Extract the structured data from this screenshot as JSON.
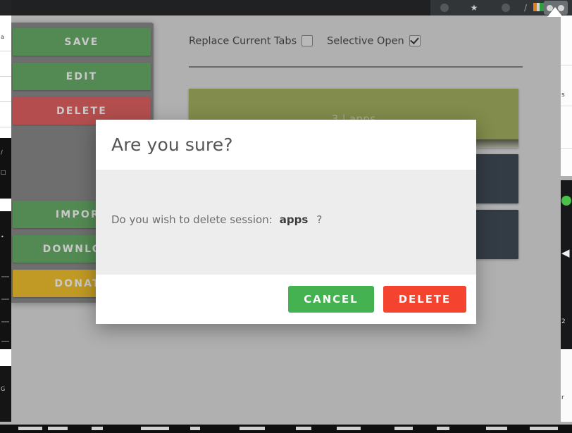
{
  "browser_chrome": {
    "icons": [
      "clock-icon",
      "star-icon",
      "account-circle-icon",
      "slash-icon",
      "extension-icon",
      "avatar-icon"
    ]
  },
  "sidebar": {
    "buttons": [
      {
        "label": "SAVE",
        "style": "green",
        "name": "save-button"
      },
      {
        "label": "EDIT",
        "style": "green",
        "name": "edit-button"
      },
      {
        "label": "DELETE",
        "style": "red",
        "name": "delete-button"
      },
      {
        "label": "IMPORT",
        "style": "green",
        "name": "import-button"
      },
      {
        "label": "DOWNLOAD",
        "style": "green",
        "name": "download-button"
      },
      {
        "label": "DONATE",
        "style": "gold",
        "name": "donate-button"
      }
    ]
  },
  "options": {
    "replace_current_tabs": {
      "label": "Replace Current Tabs",
      "checked": false
    },
    "selective_open": {
      "label": "Selective Open",
      "checked": true
    }
  },
  "sessions": [
    {
      "title": "3 | apps",
      "color": "#828c4c",
      "style": "olive"
    },
    {
      "title": "",
      "color": "#333b44",
      "style": "slate"
    },
    {
      "title": "",
      "color": "#333b44",
      "style": "slate"
    }
  ],
  "dialog": {
    "title": "Are you sure?",
    "message_prefix": "Do you wish to delete session:",
    "session_name": "apps",
    "message_suffix": "?",
    "cancel_label": "CANCEL",
    "delete_label": "DELETE",
    "cancel_color": "#44b250",
    "delete_color": "#f4432f"
  },
  "colors": {
    "page_background": "#b0b0b0",
    "sidebar_panel": "#6e6e6e",
    "button_green": "#538a53",
    "button_red": "#b44e4e",
    "button_gold": "#c09a24",
    "dialog_header": "#ffffff",
    "dialog_body": "#ededed"
  }
}
